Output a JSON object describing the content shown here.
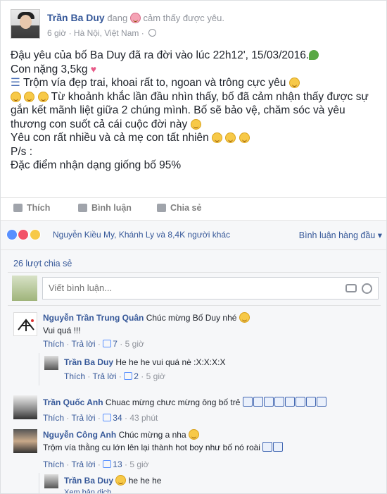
{
  "post": {
    "author": "Trần Ba Duy",
    "feeling_prefix": "đang",
    "feeling_text": "cảm thấy được yêu.",
    "time": "6 giờ",
    "location": "Hà Nội, Việt Nam",
    "lines": [
      "Đậu yêu của bố Ba Duy đã ra đời vào lúc 22h12', 15/03/2016.",
      "Con nặng 3,5kg",
      "Trộm vía đẹp trai, khoai rất to, ngoan và trông cực yêu",
      "Từ khoảnh khắc lần đầu nhìn thấy, bố đã cảm nhận thấy được sự gắn kết mãnh liệt giữa 2 chúng mình. Bố sẽ bảo vệ, chăm sóc và yêu thương con suốt cả cái cuộc đời này",
      "Yêu con rất nhiều và cả mẹ con tất nhiên",
      "P/s :",
      "Đặc điểm nhận dạng giống bố 95%"
    ]
  },
  "actions": {
    "like": "Thích",
    "comment": "Bình luận",
    "share": "Chia sẻ"
  },
  "social": {
    "likers": "Nguyễn Kiều My, Khánh Ly và 8,4K người khác",
    "top_comments": "Bình luận hàng đầu",
    "shares": "26 lượt chia sẻ"
  },
  "composer": {
    "placeholder": "Viết bình luận..."
  },
  "comments": [
    {
      "name": "Nguyễn Trần Trung Quân",
      "text": "Chúc mừng Bố Duy nhé",
      "text2": "Vui quá !!!",
      "like_label": "Thích",
      "reply_label": "Trả lời",
      "likes": "7",
      "time": "5 giờ",
      "reply": {
        "name": "Trần Ba Duy",
        "text": "He he he vui quá nè :X:X:X:X",
        "like_label": "Thích",
        "reply_label": "Trả lời",
        "likes": "2",
        "time": "5 giờ"
      }
    },
    {
      "name": "Trần Quốc Anh",
      "text": "Chuac mừng chưc mừng ông bố trẻ",
      "like_label": "Thích",
      "reply_label": "Trả lời",
      "likes": "34",
      "time": "43 phút"
    },
    {
      "name": "Nguyễn Công Anh",
      "text": "Chúc mừng a nha",
      "text2": "Trộm vía thằng cu lớn lên lại thành hot boy như bố nó roài",
      "like_label": "Thích",
      "reply_label": "Trả lời",
      "likes": "13",
      "time": "5 giờ",
      "reply": {
        "name": "Trần Ba Duy",
        "text": "he he he",
        "sub": "Xem bản dịch"
      }
    }
  ],
  "colors": {
    "link": "#365899",
    "muted": "#90949c",
    "panel": "#f6f7f9"
  }
}
